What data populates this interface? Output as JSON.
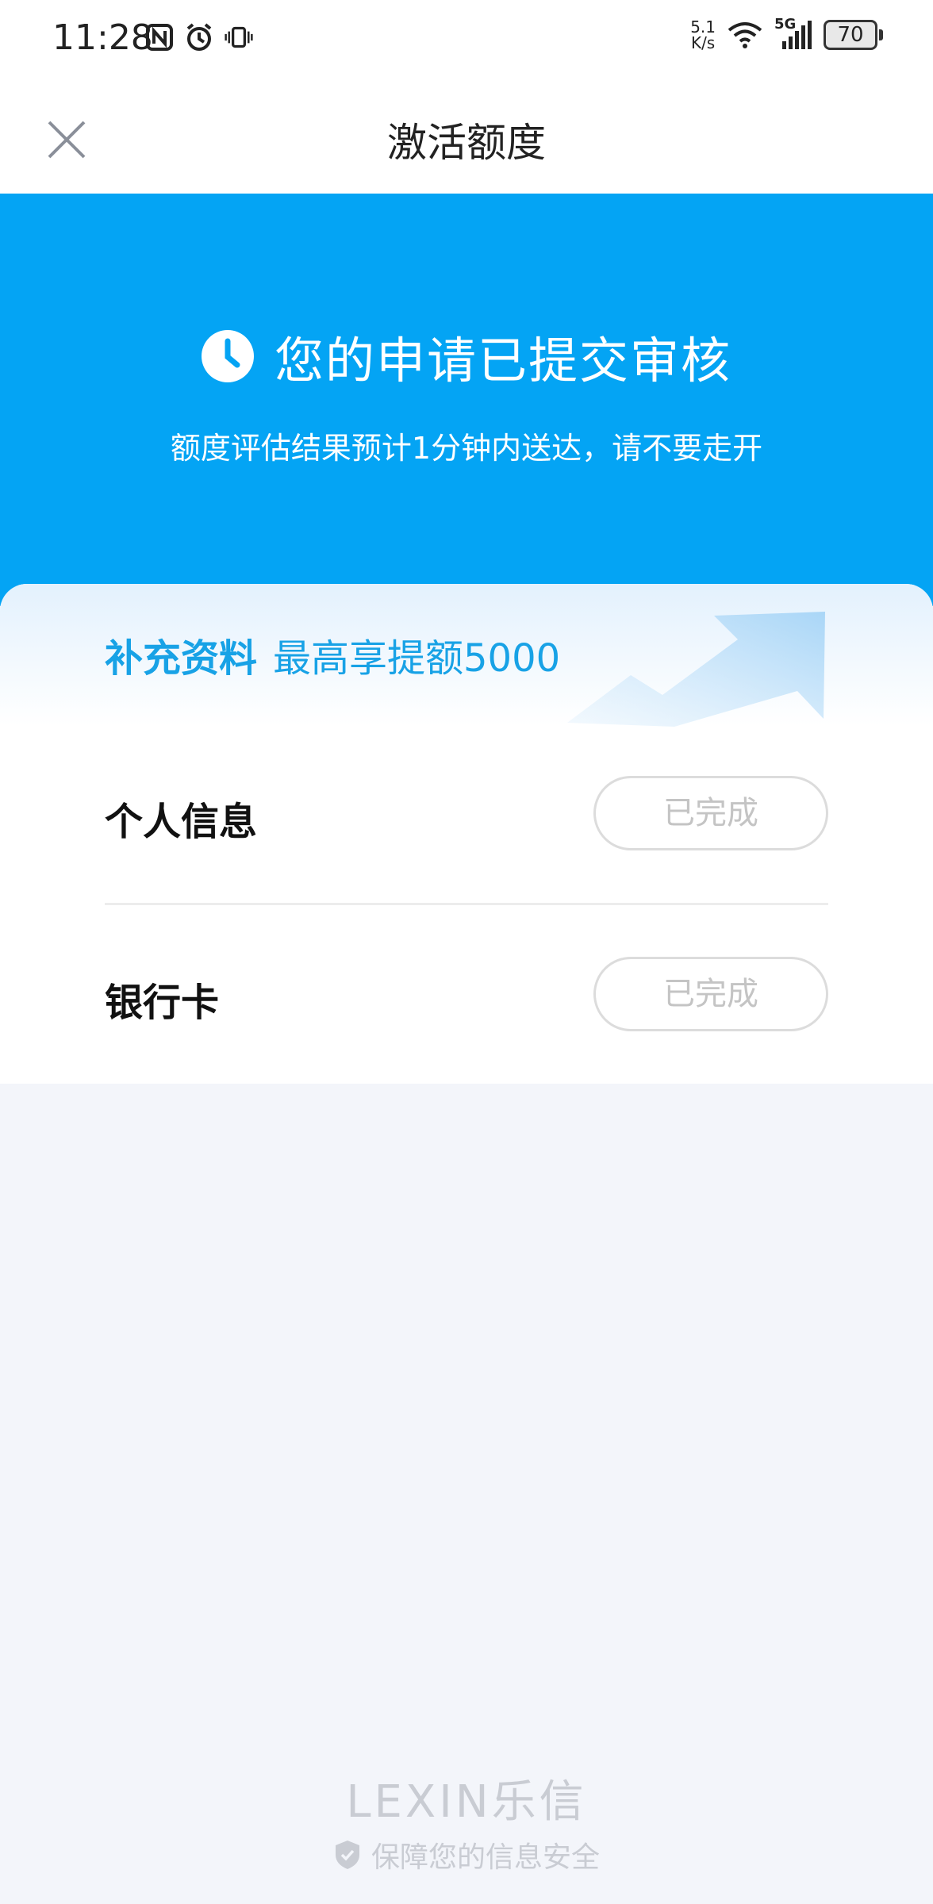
{
  "status_bar": {
    "time": "11:28",
    "net_speed_value": "5.1",
    "net_speed_unit": "K/s",
    "network": "5G",
    "battery": "70",
    "icons": [
      "nfc-icon",
      "alarm-icon",
      "vibrate-icon",
      "wifi-icon",
      "signal-icon",
      "battery-icon"
    ]
  },
  "nav": {
    "title": "激活额度",
    "close_icon": "close-icon"
  },
  "hero": {
    "title": "您的申请已提交审核",
    "subtitle": "额度评估结果预计1分钟内送达，请不要走开",
    "icon": "clock-icon",
    "bg_color": "#04a4f4"
  },
  "supplement": {
    "label": "补充资料",
    "promo": "最高享提额5000",
    "items": [
      {
        "label": "个人信息",
        "status": "已完成"
      },
      {
        "label": "银行卡",
        "status": "已完成"
      }
    ]
  },
  "footer": {
    "brand": "LEXIN乐信",
    "security_text": "保障您的信息安全",
    "icon": "shield-icon"
  }
}
